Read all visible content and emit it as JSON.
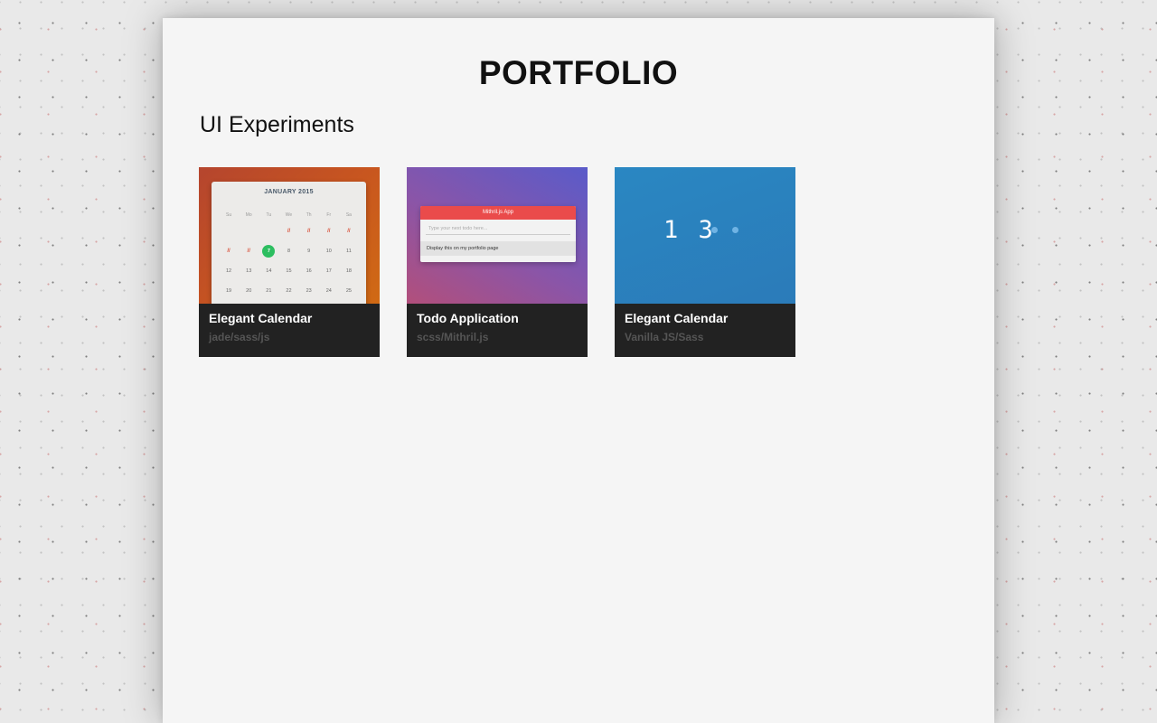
{
  "page": {
    "title": "PORTFOLIO",
    "section_title": "UI Experiments"
  },
  "colors": {
    "accent_red": "#ea4b4b",
    "calendar_today": "#2dbe60",
    "card_footer": "#222222",
    "clock_blue": "#2a87c2"
  },
  "cards": [
    {
      "title": "Elegant Calendar",
      "subtitle": "jade/sass/js",
      "thumb": {
        "month": "JANUARY 2015",
        "weekdays": [
          "Su",
          "Mo",
          "Tu",
          "We",
          "Th",
          "Fr",
          "Sa"
        ],
        "rows": [
          [
            "",
            "",
            "",
            "//",
            "//",
            "//",
            "//"
          ],
          [
            "//",
            "//",
            "7",
            "8",
            "9",
            "10",
            "11"
          ],
          [
            "12",
            "13",
            "14",
            "15",
            "16",
            "17",
            "18"
          ],
          [
            "19",
            "20",
            "21",
            "22",
            "23",
            "24",
            "25"
          ]
        ],
        "today": "7"
      }
    },
    {
      "title": "Todo Application",
      "subtitle": "scss/Mithril.js",
      "thumb": {
        "app_title": "Mithril.js App",
        "input_placeholder": "Type your next todo here...",
        "todo_item": "Display this on my portfolio page"
      }
    },
    {
      "title": "Elegant Calendar",
      "subtitle": "Vanilla JS/Sass",
      "thumb": {
        "digits": "1 3"
      }
    }
  ]
}
